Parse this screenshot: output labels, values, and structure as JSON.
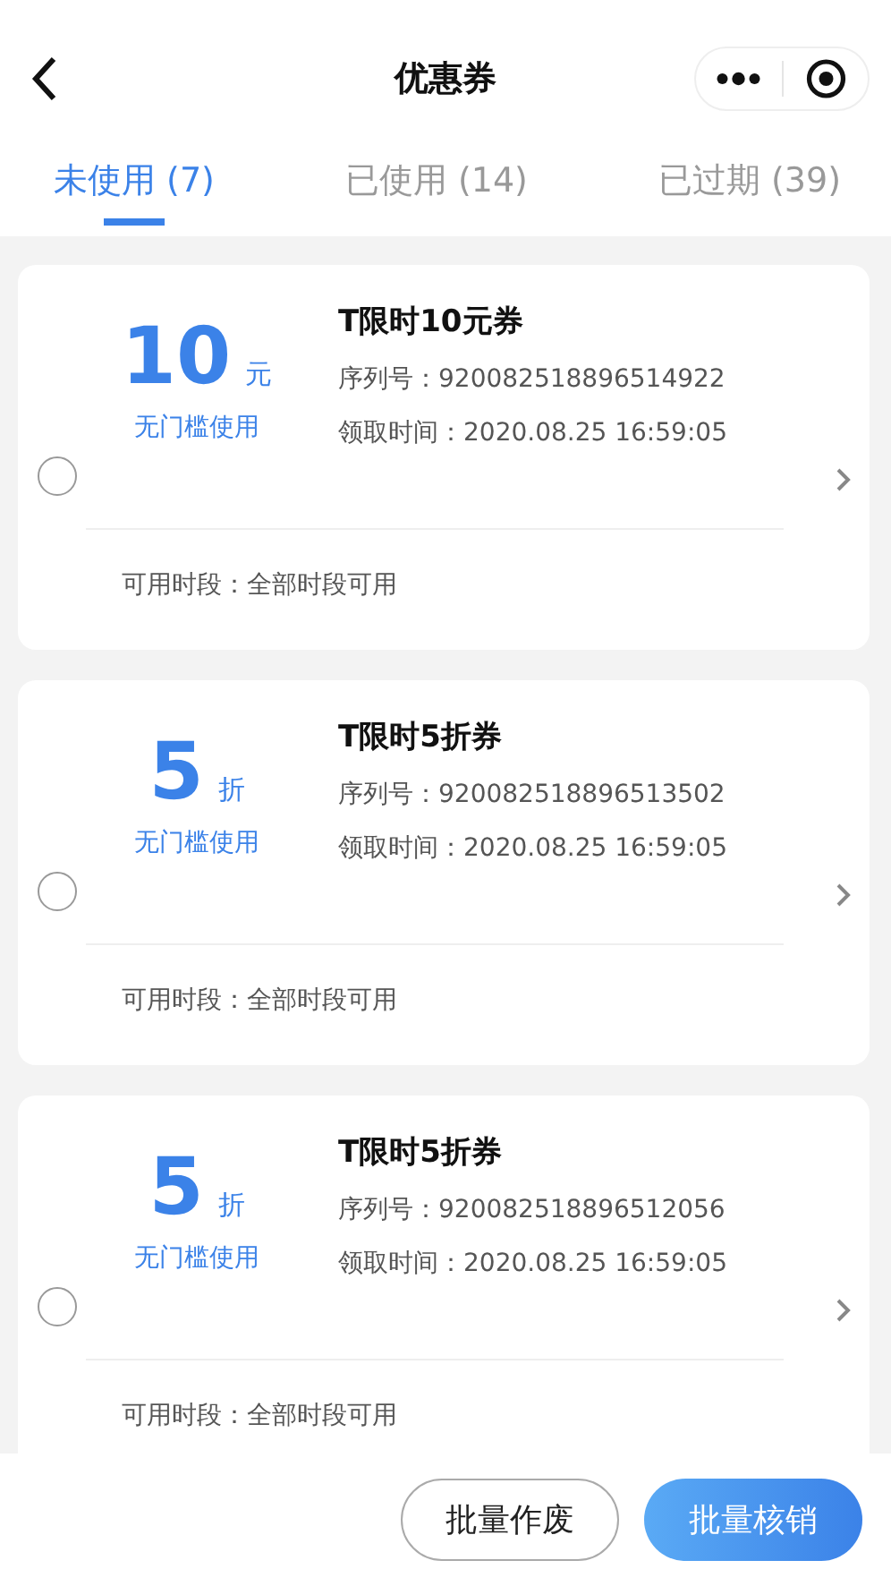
{
  "header": {
    "title": "优惠券"
  },
  "tabs": [
    {
      "label": "未使用 (7)",
      "selected": true
    },
    {
      "label": "已使用 (14)",
      "selected": false
    },
    {
      "label": "已过期 (39)",
      "selected": false
    }
  ],
  "coupons": [
    {
      "amount": "10",
      "unit": "元",
      "condition": "无门槛使用",
      "title": "T限时10元券",
      "serial": "序列号：920082518896514922",
      "received": "领取时间：2020.08.25 16:59:05",
      "period": "可用时段：全部时段可用",
      "selected": false
    },
    {
      "amount": "5",
      "unit": "折",
      "condition": "无门槛使用",
      "title": "T限时5折券",
      "serial": "序列号：920082518896513502",
      "received": "领取时间：2020.08.25 16:59:05",
      "period": "可用时段：全部时段可用",
      "selected": false
    },
    {
      "amount": "5",
      "unit": "折",
      "condition": "无门槛使用",
      "title": "T限时5折券",
      "serial": "序列号：920082518896512056",
      "received": "领取时间：2020.08.25 16:59:05",
      "period": "可用时段：全部时段可用",
      "selected": false
    }
  ],
  "buttons": [
    {
      "label": "批量作废",
      "kind": "outline"
    },
    {
      "label": "批量核销",
      "kind": "primary"
    }
  ]
}
